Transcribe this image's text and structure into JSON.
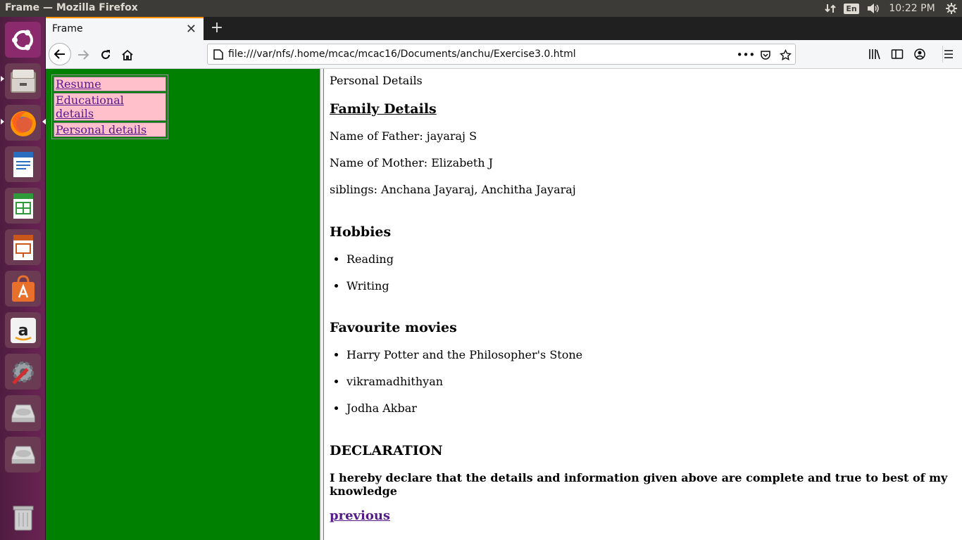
{
  "system": {
    "window_title": "Frame — Mozilla Firefox",
    "keyboard_layout": "En",
    "clock": "10:22 PM"
  },
  "launcher": {
    "items": [
      "ubuntu-dash-icon",
      "files-icon",
      "firefox-icon",
      "writer-icon",
      "calc-icon",
      "impress-icon",
      "software-center-icon",
      "amazon-icon",
      "system-settings-icon",
      "drive-icon",
      "drive-icon",
      "trash-icon"
    ]
  },
  "browser": {
    "tab_title": "Frame",
    "url": "file:///var/nfs/.home/mcac/mcac16/Documents/anchu/Exercise3.0.html",
    "page_actions_label": "•••"
  },
  "left_frame": {
    "links": [
      "Resume",
      "Educational details",
      "Personal details"
    ],
    "background": "#008000",
    "cell_background": "#ffc0cb"
  },
  "content": {
    "section_label": "Personal Details",
    "family_heading": "Family Details",
    "father": "Name of Father: jayaraj S",
    "mother": "Name of Mother: Elizabeth J",
    "siblings": "siblings: Anchana Jayaraj, Anchitha Jayaraj",
    "hobbies_heading": "Hobbies",
    "hobbies": [
      "Reading",
      "Writing"
    ],
    "movies_heading": "Favourite movies",
    "movies": [
      "Harry Potter and the Philosopher's Stone",
      "vikramadhithyan",
      "Jodha Akbar"
    ],
    "declaration_heading": "DECLARATION",
    "declaration_text": "I hereby declare that the details and information given above are complete and true to best of my knowledge",
    "previous_link": "previous"
  }
}
